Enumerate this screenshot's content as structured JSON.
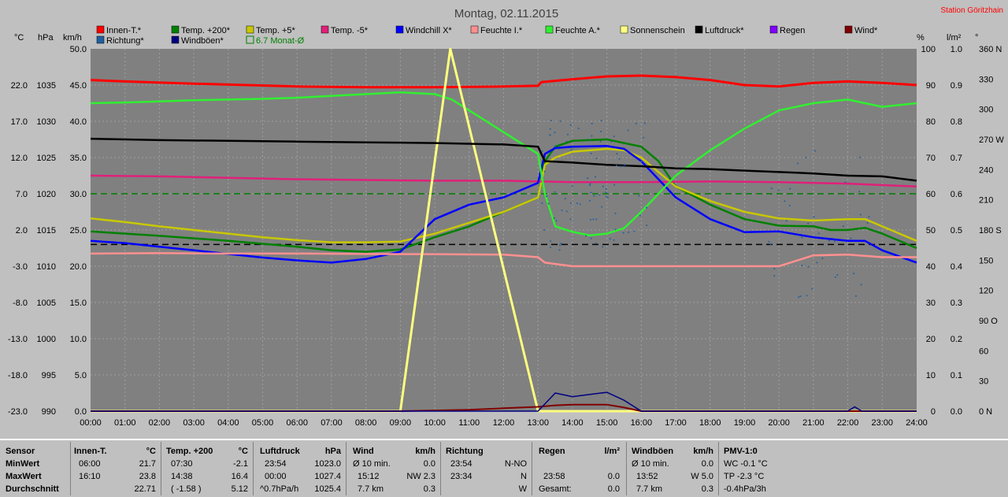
{
  "title": "Montag, 02.11.2015",
  "station": "Station Göritzhain",
  "unit_labels": {
    "temp": "°C",
    "press": "hPa",
    "speed": "km/h",
    "percent": "%",
    "rain": "l/m²",
    "deg": "°"
  },
  "legend": [
    {
      "label": "Innen-T.*",
      "color": "#ff0000"
    },
    {
      "label": "Temp. +200*",
      "color": "#008000"
    },
    {
      "label": "Temp. +5*",
      "color": "#c8c800"
    },
    {
      "label": "Temp. -5*",
      "color": "#e0207a"
    },
    {
      "label": "Windchill X*",
      "color": "#0000ff"
    },
    {
      "label": "Feuchte I.*",
      "color": "#ff9090"
    },
    {
      "label": "Feuchte A.*",
      "color": "#30f030"
    },
    {
      "label": "Sonnenschein",
      "color": "#ffff80"
    },
    {
      "label": "Luftdruck*",
      "color": "#000000"
    },
    {
      "label": "Regen",
      "color": "#8000ff"
    },
    {
      "label": "Wind*",
      "color": "#800000"
    },
    {
      "label": "Richtung*",
      "color": "#2060a0"
    },
    {
      "label": "Windböen*",
      "color": "#000080"
    },
    {
      "label": "6.7 Monat-Ø",
      "color": "#008000"
    }
  ],
  "chart_data": {
    "type": "line",
    "title": "Montag, 02.11.2015",
    "x_ticks": [
      "00:00",
      "01:00",
      "02:00",
      "03:00",
      "04:00",
      "05:00",
      "06:00",
      "07:00",
      "08:00",
      "09:00",
      "10:00",
      "11:00",
      "12:00",
      "13:00",
      "14:00",
      "15:00",
      "16:00",
      "17:00",
      "18:00",
      "19:00",
      "20:00",
      "21:00",
      "22:00",
      "23:00",
      "24:00"
    ],
    "y_axes": {
      "temp": {
        "unit": "°C",
        "range": [
          -23,
          27
        ],
        "ticks": [
          "22.0",
          "17.0",
          "12.0",
          "7.0",
          "2.0",
          "-3.0",
          "-8.0",
          "-13.0",
          "-18.0",
          "-23.0"
        ]
      },
      "press": {
        "unit": "hPa",
        "range": [
          990,
          1040
        ],
        "ticks": [
          "1035",
          "1030",
          "1025",
          "1020",
          "1015",
          "1010",
          "1005",
          "1000",
          "995",
          "990"
        ]
      },
      "speed": {
        "unit": "km/h",
        "range": [
          0,
          50
        ],
        "ticks": [
          "50.0",
          "45.0",
          "40.0",
          "35.0",
          "30.0",
          "25.0",
          "20.0",
          "15.0",
          "10.0",
          "5.0",
          "0.0"
        ]
      },
      "percent": {
        "unit": "%",
        "range": [
          0,
          100
        ],
        "ticks": [
          "100",
          "90",
          "80",
          "70",
          "60",
          "50",
          "40",
          "30",
          "20",
          "10",
          "0"
        ]
      },
      "rain": {
        "unit": "l/m²",
        "range": [
          0,
          1.0
        ],
        "ticks": [
          "1.0",
          "0.9",
          "0.8",
          "0.7",
          "0.6",
          "0.5",
          "0.4",
          "0.3",
          "0.2",
          "0.1",
          "0.0"
        ]
      },
      "dir": {
        "unit": "°",
        "range": [
          0,
          360
        ],
        "ticks": [
          "360 N",
          "330",
          "300",
          "270 W",
          "240",
          "210",
          "180 S",
          "150",
          "120",
          "90 O",
          "60",
          "30",
          "0 N"
        ]
      }
    },
    "reference_lines": [
      {
        "axis": "temp",
        "value": 7.0,
        "style": "dashed",
        "color": "#008000"
      },
      {
        "axis": "temp",
        "value": 0.0,
        "style": "dashed",
        "color": "#000000"
      }
    ],
    "series": [
      {
        "name": "Innen-T.*",
        "color": "#ff0000",
        "axis": "temp",
        "x": [
          0,
          1,
          3,
          6,
          8,
          10,
          12,
          13,
          13.1,
          14,
          15,
          16,
          17,
          18,
          19,
          20,
          21,
          22,
          23,
          24
        ],
        "y": [
          22.7,
          22.5,
          22.2,
          21.8,
          21.7,
          21.7,
          21.8,
          21.9,
          22.4,
          22.8,
          23.2,
          23.3,
          23.1,
          22.7,
          22.0,
          21.8,
          22.3,
          22.5,
          22.3,
          22.0
        ]
      },
      {
        "name": "Temp. +200*",
        "color": "#008000",
        "axis": "temp",
        "x": [
          0,
          2,
          4,
          6,
          7,
          8,
          9,
          10,
          11,
          12,
          13,
          13.2,
          13.5,
          14,
          15,
          16,
          16.5,
          17,
          18,
          19,
          20,
          21,
          21.5,
          22,
          22.5,
          23,
          24
        ],
        "y": [
          1.8,
          1.2,
          0.5,
          -0.3,
          -0.8,
          -1.0,
          -0.7,
          1.0,
          2.5,
          4.5,
          6.5,
          11.5,
          13.5,
          14.3,
          14.5,
          13.5,
          11.5,
          8.0,
          5.5,
          3.5,
          2.6,
          2.5,
          2.0,
          2.0,
          2.3,
          1.5,
          -0.5
        ]
      },
      {
        "name": "Temp. +5*",
        "color": "#c8c800",
        "axis": "temp",
        "x": [
          0,
          1,
          2,
          3,
          4,
          5,
          6,
          7,
          8,
          9,
          10,
          11,
          12,
          13,
          13.2,
          13.5,
          14,
          15,
          15.5,
          16,
          16.5,
          17,
          18,
          19,
          20,
          21,
          22,
          22.5,
          23,
          24
        ],
        "y": [
          3.6,
          3.1,
          2.5,
          2.0,
          1.5,
          1.0,
          0.6,
          0.3,
          0.3,
          0.4,
          1.5,
          3.0,
          4.5,
          6.5,
          11.0,
          12.0,
          12.8,
          13.2,
          13.0,
          12.0,
          10.0,
          8.0,
          6.0,
          4.5,
          3.6,
          3.3,
          3.5,
          3.5,
          2.5,
          0.5
        ]
      },
      {
        "name": "Temp. -5*",
        "color": "#e0207a",
        "axis": "temp",
        "x": [
          0,
          2,
          4,
          6,
          8,
          10,
          12,
          14,
          16,
          18,
          20,
          22,
          24
        ],
        "y": [
          9.5,
          9.4,
          9.2,
          9.0,
          8.9,
          8.8,
          8.8,
          8.6,
          8.6,
          8.7,
          8.6,
          8.4,
          8.0
        ]
      },
      {
        "name": "Windchill X*",
        "color": "#0000ff",
        "axis": "temp",
        "x": [
          0,
          1,
          2,
          3,
          4,
          5,
          6,
          7,
          8,
          9,
          10,
          11,
          12,
          13,
          13.2,
          13.5,
          14,
          15,
          15.5,
          16,
          16.5,
          17,
          18,
          19,
          20,
          21,
          22,
          22.5,
          23,
          24
        ],
        "y": [
          0.5,
          0.2,
          -0.3,
          -0.8,
          -1.3,
          -1.8,
          -2.2,
          -2.5,
          -2.0,
          -1.0,
          3.5,
          5.5,
          6.5,
          8.5,
          12.5,
          13.3,
          13.5,
          13.6,
          13.2,
          11.5,
          9.0,
          6.5,
          3.5,
          1.7,
          1.8,
          1.0,
          0.5,
          0.5,
          -0.8,
          -2.5
        ]
      },
      {
        "name": "Feuchte I.*",
        "color": "#ff9090",
        "axis": "percent",
        "x": [
          0,
          2,
          4,
          6,
          8,
          10,
          12,
          13,
          13.2,
          14,
          16,
          18,
          19,
          20,
          21,
          22,
          23,
          24
        ],
        "y": [
          43.5,
          43.6,
          43.5,
          43.5,
          43.4,
          43.3,
          43.2,
          42.5,
          41.0,
          40.0,
          40.0,
          40.0,
          40.0,
          40.0,
          43.0,
          43.2,
          42.5,
          42.5
        ]
      },
      {
        "name": "Feuchte A.*",
        "color": "#30f030",
        "axis": "percent",
        "x": [
          0,
          1,
          2,
          3,
          4,
          5,
          6,
          7,
          8,
          9,
          10,
          10.5,
          11,
          12,
          13,
          13.2,
          13.5,
          14,
          14.5,
          15,
          15.5,
          16,
          17,
          18,
          19,
          20,
          21,
          21.5,
          22,
          22.5,
          23,
          24
        ],
        "y": [
          85.0,
          85.2,
          85.5,
          85.8,
          86.0,
          86.2,
          86.5,
          87.0,
          87.5,
          88.0,
          87.5,
          86.0,
          83.0,
          77.0,
          71.0,
          60.0,
          51.0,
          49.5,
          48.5,
          49.0,
          50.5,
          55.0,
          65.0,
          72.0,
          78.0,
          83.0,
          85.0,
          85.5,
          86.0,
          85.0,
          84.0,
          85.0
        ]
      },
      {
        "name": "Sonnenschein",
        "color": "#ffff80",
        "axis": "speed",
        "x": [
          0,
          9,
          10.45,
          13.0,
          24
        ],
        "y": [
          0,
          0,
          50,
          0,
          0
        ]
      },
      {
        "name": "Luftdruck*",
        "color": "#000000",
        "axis": "press",
        "x": [
          0,
          1,
          2,
          4,
          6,
          8,
          10,
          12,
          13,
          13.2,
          14,
          15,
          16,
          17,
          18,
          19,
          20,
          21,
          22,
          23,
          24
        ],
        "y": [
          1027.6,
          1027.5,
          1027.4,
          1027.3,
          1027.2,
          1027.1,
          1027.0,
          1026.8,
          1026.5,
          1024.5,
          1024.3,
          1024.0,
          1023.8,
          1023.5,
          1023.4,
          1023.2,
          1023.0,
          1022.8,
          1022.5,
          1022.4,
          1021.8
        ]
      },
      {
        "name": "Wind*",
        "color": "#800000",
        "axis": "speed",
        "x": [
          0,
          9,
          10,
          11,
          12,
          13,
          13.5,
          14,
          15,
          15.5,
          16,
          24
        ],
        "y": [
          0,
          0,
          0.1,
          0.2,
          0.4,
          0.6,
          0.8,
          0.9,
          0.9,
          0.5,
          0,
          0
        ]
      },
      {
        "name": "Windböen*",
        "color": "#000080",
        "axis": "speed",
        "x": [
          0,
          13,
          13.5,
          14,
          15,
          15.5,
          16,
          22,
          22.2,
          22.4,
          24
        ],
        "y": [
          0,
          0,
          2.5,
          2.0,
          2.6,
          1.5,
          0,
          0,
          0.6,
          0,
          0
        ]
      }
    ]
  },
  "stats": {
    "sensor": {
      "header": "Sensor",
      "rows": [
        "MinWert",
        "MaxWert",
        "Durchschnitt"
      ]
    },
    "innen": {
      "header": "Innen-T.",
      "unit": "°C",
      "rows": [
        [
          "06:00",
          "21.7"
        ],
        [
          "16:10",
          "23.8"
        ],
        [
          "",
          "22.71"
        ]
      ]
    },
    "temp200": {
      "header": "Temp. +200",
      "unit": "°C",
      "rows": [
        [
          "07:30",
          "-2.1"
        ],
        [
          "14:38",
          "16.4"
        ],
        [
          "( -1.58 )",
          "5.12"
        ]
      ]
    },
    "druck": {
      "header": "Luftdruck",
      "unit": "hPa",
      "rows": [
        [
          "23:54",
          "1023.0"
        ],
        [
          "00:00",
          "1027.4"
        ],
        [
          "^0.7hPa/h",
          "1025.4"
        ]
      ]
    },
    "wind": {
      "header": "Wind",
      "unit": "km/h",
      "rows": [
        [
          "Ø 10 min.",
          "0.0"
        ],
        [
          "15:12",
          "NW 2.3"
        ],
        [
          "7.7 km",
          "0.3"
        ]
      ]
    },
    "richtung": {
      "header": "Richtung",
      "unit": "",
      "rows": [
        [
          "23:54",
          "N-NO"
        ],
        [
          "23:34",
          "N"
        ],
        [
          "",
          "W"
        ]
      ]
    },
    "regen": {
      "header": "Regen",
      "unit": "l/m²",
      "rows": [
        [
          "",
          ""
        ],
        [
          "23:58",
          "0.0"
        ],
        [
          "Gesamt:",
          "0.0"
        ]
      ]
    },
    "boeen": {
      "header": "Windböen",
      "unit": "km/h",
      "rows": [
        [
          "Ø 10 min.",
          "0.0"
        ],
        [
          "13:52",
          "W 5.0"
        ],
        [
          "7.7 km",
          "0.3"
        ]
      ]
    },
    "pmv": {
      "header": "PMV-1:0",
      "rows": [
        "WC -0.1 °C",
        "TP -2.3 °C",
        "-0.4hPa/3h"
      ]
    }
  }
}
